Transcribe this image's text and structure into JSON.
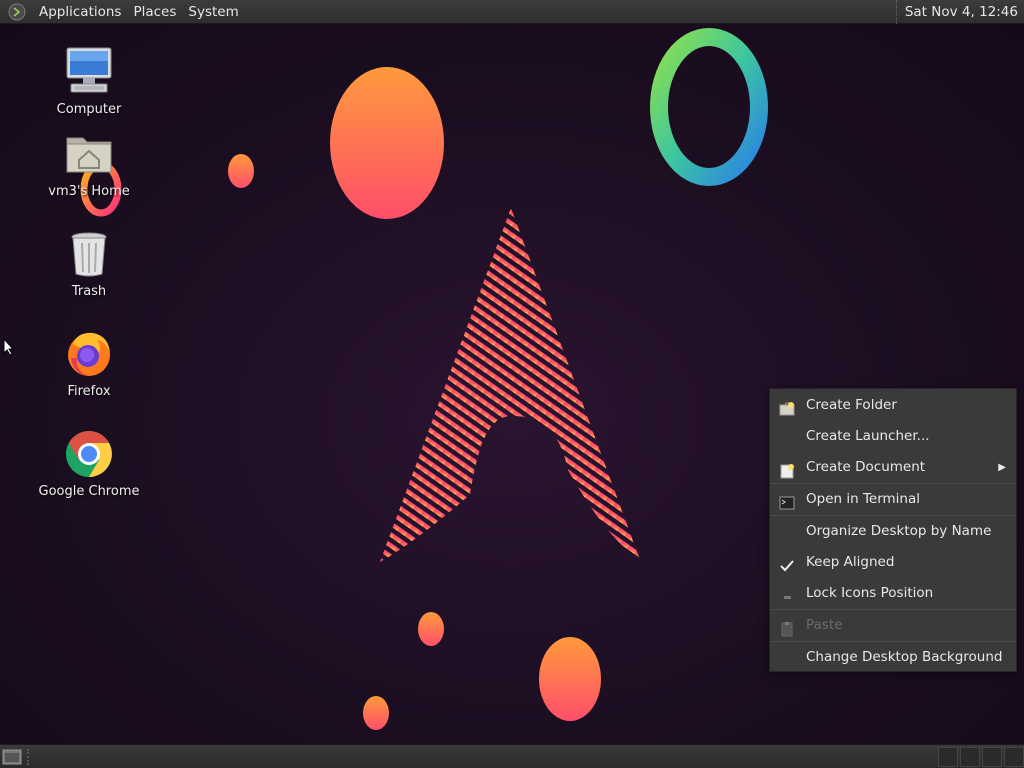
{
  "top_panel": {
    "menus": [
      "Applications",
      "Places",
      "System"
    ],
    "clock": "Sat Nov  4, 12:46"
  },
  "desktop_icons": [
    {
      "label": "Computer",
      "icon": "computer-icon"
    },
    {
      "label": "vm3's Home",
      "icon": "home-folder-icon"
    },
    {
      "label": "Trash",
      "icon": "trash-icon"
    },
    {
      "label": "Firefox",
      "icon": "firefox-icon"
    },
    {
      "label": "Google Chrome",
      "icon": "chrome-icon"
    }
  ],
  "context_menu": {
    "items": [
      {
        "label": "Create Folder",
        "icon": "new-folder-icon"
      },
      {
        "label": "Create Launcher...",
        "icon": ""
      },
      {
        "label": "Create Document",
        "icon": "new-document-icon",
        "submenu": true
      },
      {
        "label": "Open in Terminal",
        "icon": "terminal-icon"
      },
      {
        "label": "Organize Desktop by Name",
        "icon": ""
      },
      {
        "label": "Keep Aligned",
        "icon": "checkmark-icon",
        "checked": true
      },
      {
        "label": "Lock Icons Position",
        "icon": "unchecked-dash-icon",
        "checked": false
      },
      {
        "label": "Paste",
        "icon": "paste-icon",
        "disabled": true
      },
      {
        "label": "Change Desktop Background",
        "icon": ""
      }
    ]
  },
  "colors": {
    "panel": "#333333",
    "menu_bg": "#3a3a3a",
    "wallpaper_bg": "#1c0e21",
    "accent_orange": "#ff8c3a",
    "accent_pink": "#ff3d7f"
  }
}
